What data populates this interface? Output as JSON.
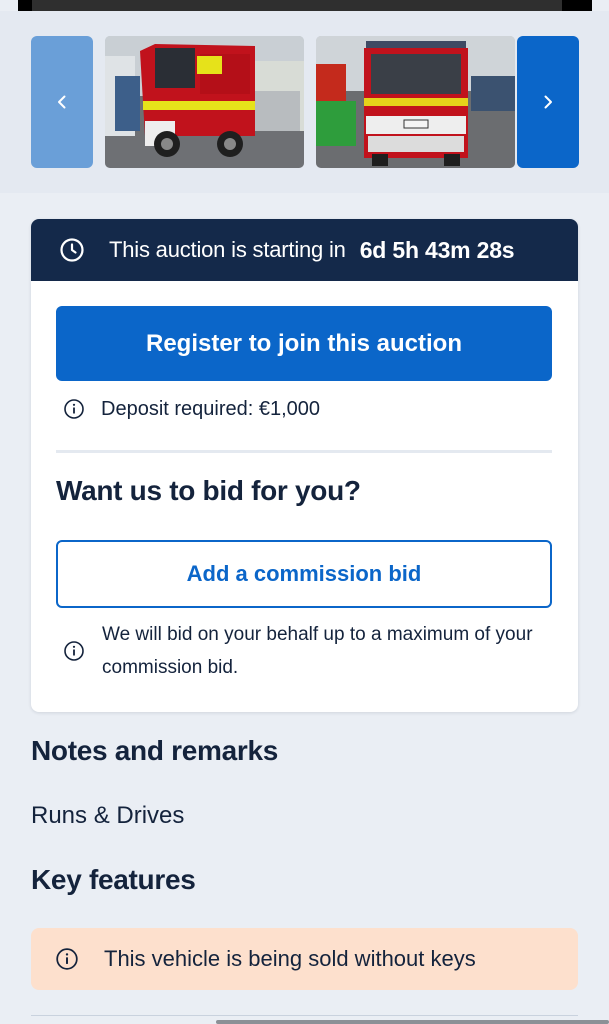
{
  "gallery": {
    "prev_icon": "chevron-left-icon",
    "next_icon": "chevron-right-icon",
    "images": [
      {
        "subject": "fire truck side view"
      },
      {
        "subject": "fire truck front view"
      }
    ],
    "colors": {
      "prev": "#6a9fd8",
      "next": "#0b66c9"
    }
  },
  "auction": {
    "header_icon": "clock-icon",
    "starting_label": "This auction is starting in",
    "countdown": "6d 5h 43m 28s",
    "register_label": "Register to join this auction",
    "deposit_icon": "info-icon",
    "deposit_text": "Deposit required: €1,000",
    "bid_title": "Want us to bid for you?",
    "commission_label": "Add a commission bid",
    "commission_note": "We will bid on your behalf up to a maximum of your commission bid.",
    "colors": {
      "header": "#14294a",
      "accent": "#0b66c9"
    }
  },
  "notes": {
    "title": "Notes and remarks",
    "text": "Runs & Drives"
  },
  "features": {
    "title": "Key features",
    "items": [
      {
        "icon": "info-icon",
        "text": "This vehicle is being sold without keys"
      }
    ],
    "colors": {
      "banner": "#fde0cd"
    }
  }
}
